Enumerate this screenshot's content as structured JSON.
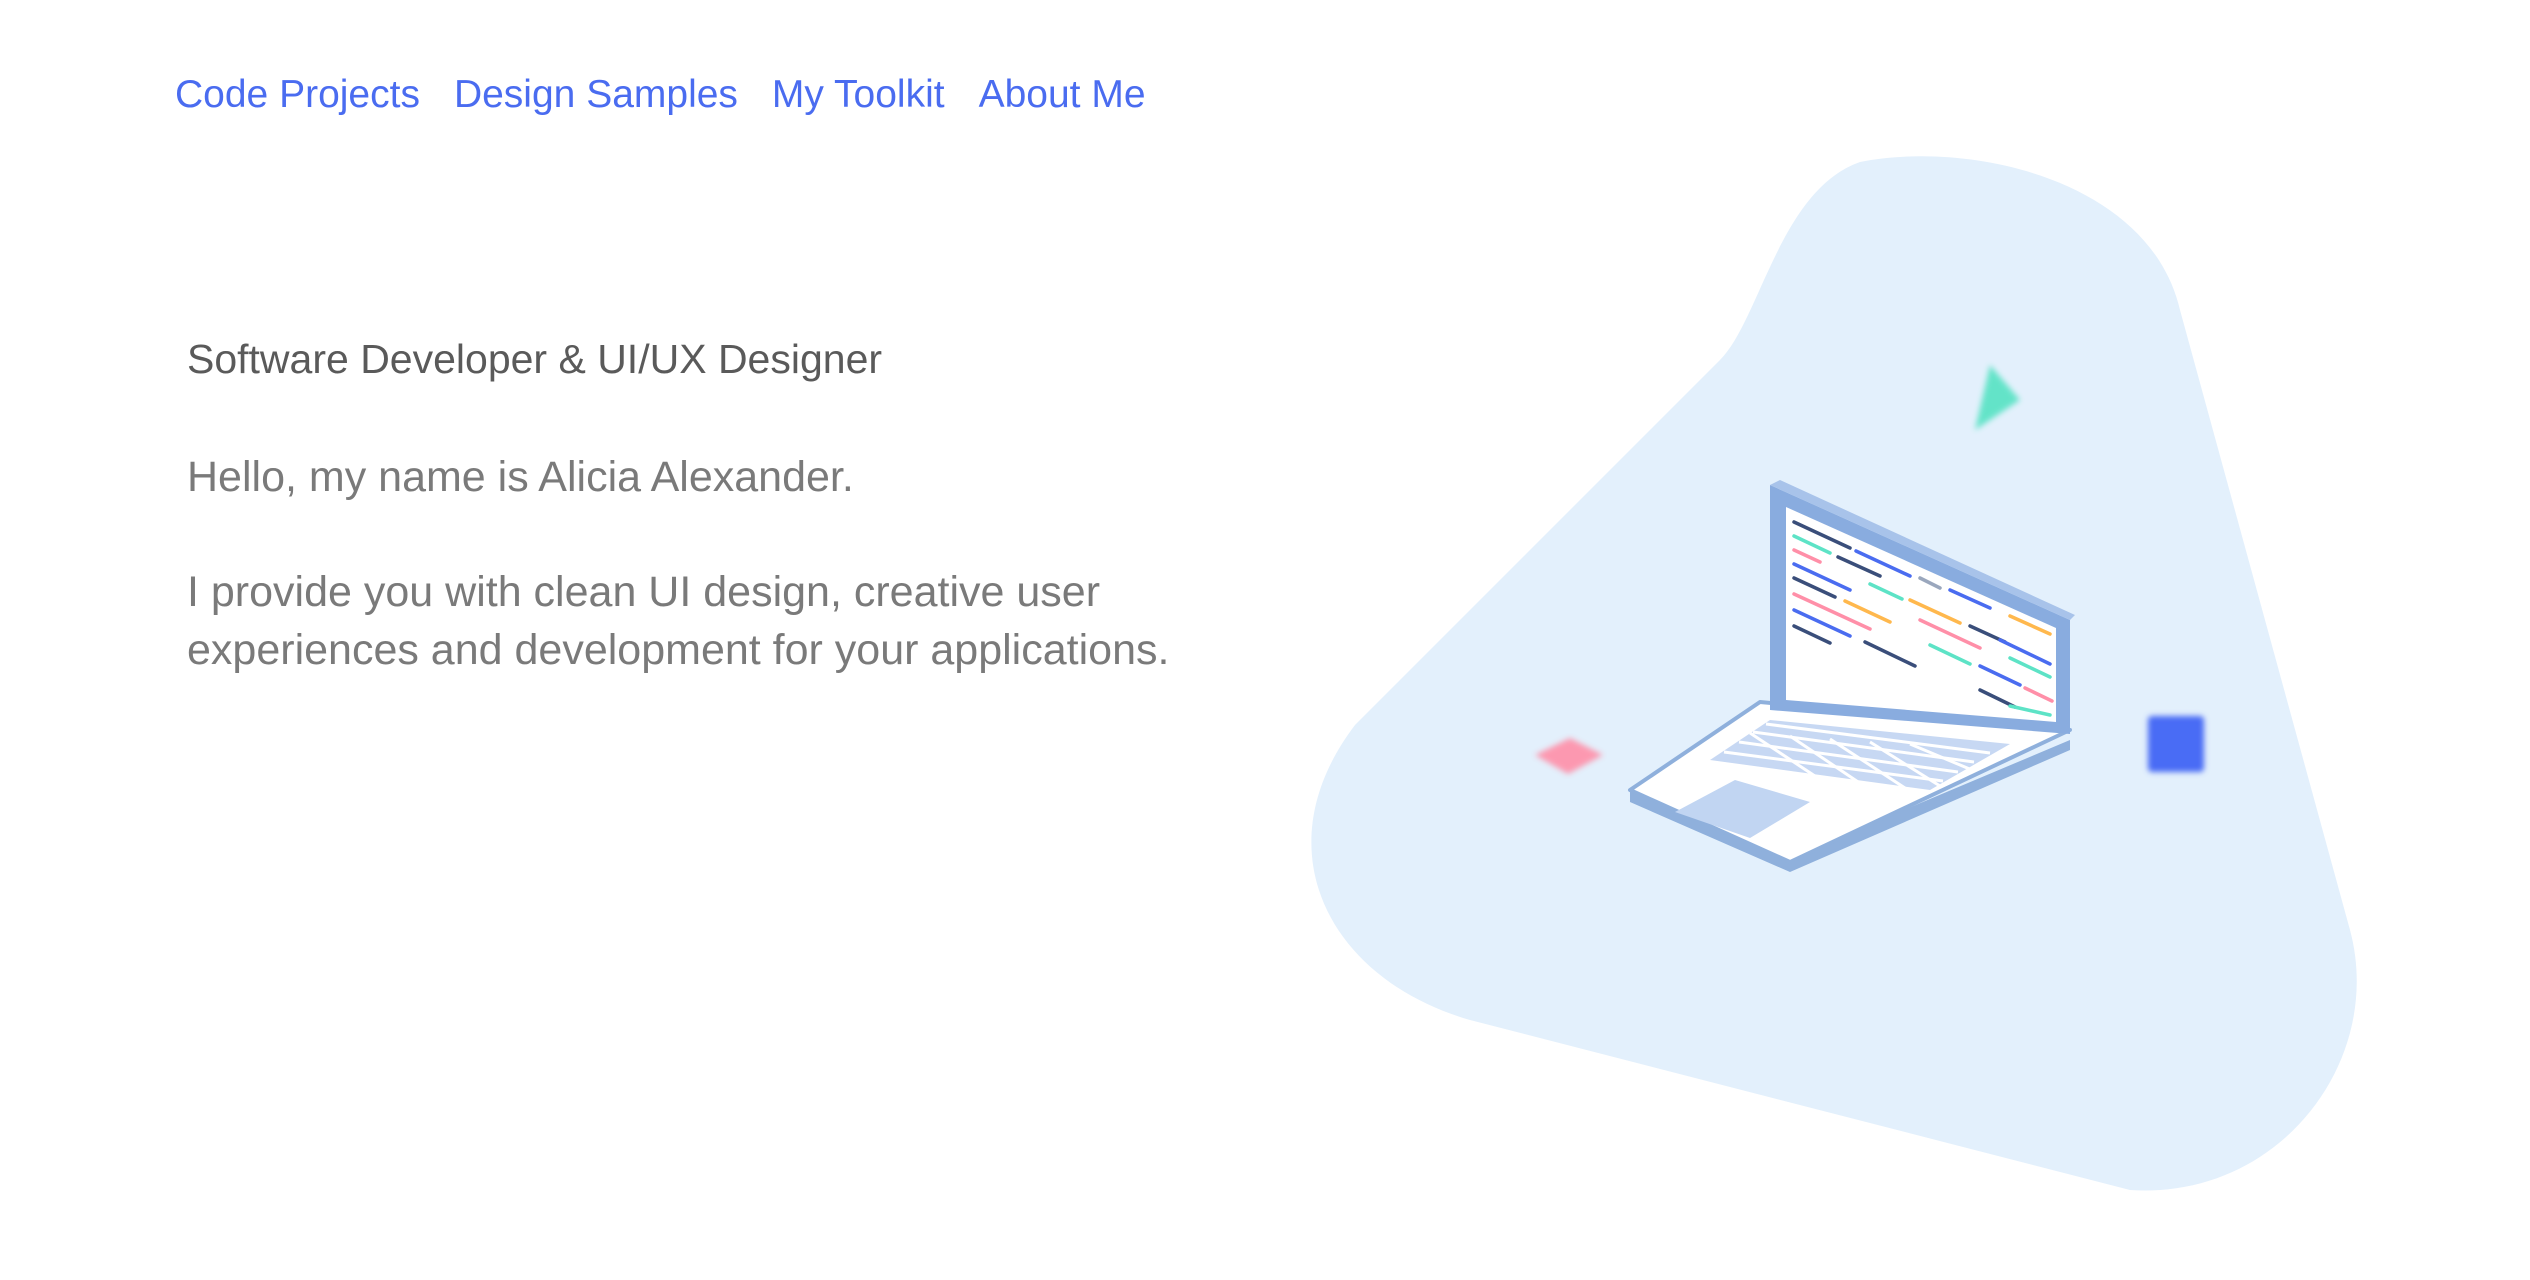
{
  "nav": {
    "items": [
      {
        "label": "Code Projects"
      },
      {
        "label": "Design Samples"
      },
      {
        "label": "My Toolkit"
      },
      {
        "label": "About Me"
      }
    ]
  },
  "hero": {
    "subtitle": "Software Developer & UI/UX Designer",
    "greeting": "Hello, my name is Alicia Alexander.",
    "description": "I provide you with clean UI design, creative user experiences and development for your applications."
  },
  "colors": {
    "accent": "#4a6cf0",
    "blob": "#e3f0fc",
    "shape_teal": "#5de3c6",
    "shape_pink": "#ff8fa8",
    "shape_blue": "#4a6cf5"
  }
}
